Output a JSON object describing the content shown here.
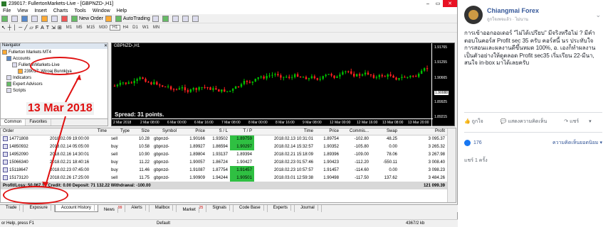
{
  "window": {
    "title": "239017: FullertonMarkets-Live - [GBPNZD-,H1]",
    "minimize": "–",
    "maximize": "▭",
    "close": "✕"
  },
  "menu": [
    "File",
    "View",
    "Insert",
    "Charts",
    "Tools",
    "Window",
    "Help"
  ],
  "toolbar": {
    "new_order": "New Order",
    "autotrading": "AutoTrading",
    "timeframes": [
      "M1",
      "M5",
      "M15",
      "M30",
      "H1",
      "H4",
      "D1",
      "W1",
      "MN"
    ],
    "active_timeframe": "H1"
  },
  "navigator": {
    "title": "Navigator",
    "root": "Fullerton Markets MT4",
    "accounts": "Accounts",
    "server": "FullertonMarkets-Live",
    "account": "239017: Wiroaj Bunnkjya",
    "indicators": "Indicators",
    "experts": "Expert Advisors",
    "scripts": "Scripts",
    "tabs": [
      "Common",
      "Favorites"
    ]
  },
  "chart": {
    "symbol": "GBPNZD-,H1",
    "spread": "Spread: 31 points.",
    "price_labels": [
      "1.91765",
      "1.91255",
      "1.90665",
      "1.90088",
      "1.89925",
      "1.89215"
    ],
    "current_price": "1.90088",
    "time_labels": [
      "2 Mar 2018",
      "2 Mar 08:00",
      "6 Mar 00:00",
      "6 Mar 16:00",
      "7 Mar 08:00",
      "8 Mar 00:00",
      "8 Mar 16:00",
      "9 Mar 08:00",
      "12 Mar 00:00",
      "12 Mar 16:00",
      "13 Mar 08:00",
      "13 Mar 20:00"
    ],
    "bull_color": "#00c000",
    "bear_color": "#ff2020"
  },
  "annotation": {
    "date_label": "13 Mar 2018",
    "color": "#e01010"
  },
  "terminal": {
    "columns": [
      "Order",
      "Time",
      "Type",
      "Size",
      "Symbol",
      "Price",
      "S / L",
      "T / P",
      "Time",
      "Price",
      "Commis...",
      "Swap",
      "Profit"
    ],
    "rows": [
      [
        "14771808",
        "2018.02.09 19:00:00",
        "sell",
        "10.28",
        "gbpnzd-",
        "1.90166",
        "1.93502",
        "1.89759",
        "2018.02.13 10:31:01",
        "1.89754",
        "-102.80",
        "48.25",
        "3 095.37"
      ],
      [
        "14850932",
        "2018.02.14 05:05:00",
        "buy",
        "10.58",
        "gbpnzd-",
        "1.89927",
        "1.86594",
        "1.90297",
        "2018.02.14 15:32:57",
        "1.90352",
        "-105.80",
        "0.00",
        "3 265.32"
      ],
      [
        "14952090",
        "2018.02.16 14:30:01",
        "sell",
        "10.90",
        "gbpnzd-",
        "1.89804",
        "1.93137",
        "1.89394",
        "2018.02.21 15:18:09",
        "1.89396",
        "-109.00",
        "78.06",
        "3 267.98"
      ],
      [
        "15066340",
        "2018.02.21 18:40:16",
        "buy",
        "11.22",
        "gbpnzd-",
        "1.90057",
        "1.86724",
        "1.90427",
        "2018.02.23 01:57:46",
        "1.90423",
        "-112.20",
        "-550.11",
        "3 008.40"
      ],
      [
        "15118647",
        "2018.02.23 07:45:00",
        "buy",
        "11.46",
        "gbpnzd-",
        "1.91087",
        "1.87754",
        "1.91457",
        "2018.02.23 10:57:57",
        "1.91457",
        "-114.60",
        "0.00",
        "3 098.23"
      ],
      [
        "15173120",
        "2018.02.26 17:25:00",
        "sell",
        "11.75",
        "gbpnzd-",
        "1.90909",
        "1.94244",
        "1.90501",
        "2018.03.01 12:59:38",
        "1.90498",
        "-117.50",
        "137.62",
        "3 484.26"
      ]
    ],
    "tp_highlight_rows": [
      0,
      1,
      4,
      5
    ],
    "summary": {
      "label": "Profit/Loss: 50 067.17",
      "credit": "Credit: 0.00",
      "deposit": "Deposit: 71 132.22",
      "withdrawal": "Withdrawal: -100.00",
      "total": "121 099.39"
    },
    "tabs": [
      {
        "label": "Trade"
      },
      {
        "label": "Exposure"
      },
      {
        "label": "Account History"
      },
      {
        "label": "News",
        "badge": "99"
      },
      {
        "label": "Alerts"
      },
      {
        "label": "Mailbox"
      },
      {
        "label": "Market",
        "badge": "25"
      },
      {
        "label": "Signals"
      },
      {
        "label": "Code Base"
      },
      {
        "label": "Experts"
      },
      {
        "label": "Journal"
      }
    ],
    "active_tab": "Account History"
  },
  "status": {
    "help": "or Help, press F1",
    "profile": "Default",
    "traffic": "4367/2 kb"
  },
  "facebook": {
    "page_name": "Chiangmai Forex",
    "subtitle": "ถูกใจเพจแล้ว · ไม่นาน",
    "post": "การเข้าออกออเดอร์ \"ไม่ได้เปรียบ\" มีจริงหรือไม่ ? มีคำตอบในคอร์ส Profit sec 35 ครับ คอร์สนี้ นร ประทับใจการสอนและผลงานดีขึ้นหมด 100%, อ. เองก็ทำผลงานเป็นตัวอย่างให้ดูตลอด Profit sec35 เริ่มเรียน 22-มีนา, สนใจ in-box มาได้เลยครับ",
    "like": "ถูกใจ",
    "comment": "แสดงความคิดเห็น",
    "share": "แชร์",
    "reactions": "176",
    "sort": "ความคิดเห็นยอดนิยม ▾",
    "shares": "แชร์ 1 ครั้ง"
  }
}
